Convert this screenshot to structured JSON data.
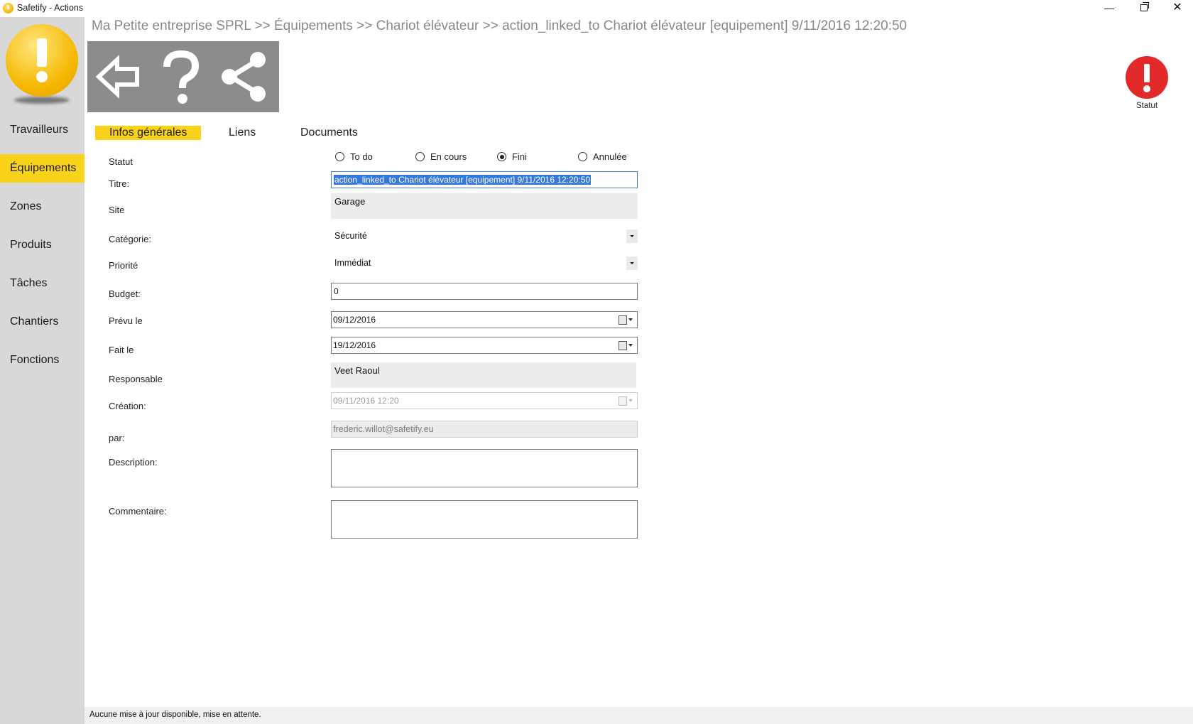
{
  "window": {
    "title": "Safetify - Actions",
    "minimize_glyph": "—",
    "close_glyph": "✕"
  },
  "breadcrumb": "Ma Petite entreprise SPRL >> Équipements >> Chariot élévateur >> action_linked_to Chariot élévateur [equipement]  9/11/2016 12:20:50",
  "sidebar": {
    "items": [
      {
        "label": "Travailleurs",
        "active": false
      },
      {
        "label": "Équipements",
        "active": true
      },
      {
        "label": "Zones",
        "active": false
      },
      {
        "label": "Produits",
        "active": false
      },
      {
        "label": "Tâches",
        "active": false
      },
      {
        "label": "Chantiers",
        "active": false
      },
      {
        "label": "Fonctions",
        "active": false
      }
    ]
  },
  "toolbar": {
    "buttons": [
      "back-arrow-icon",
      "help-question-icon",
      "share-icon"
    ]
  },
  "status_indicator": {
    "label": "Statut",
    "color": "#e32a2a"
  },
  "tabs": [
    {
      "label": "Infos générales",
      "active": true
    },
    {
      "label": "Liens",
      "active": false
    },
    {
      "label": "Documents",
      "active": false
    }
  ],
  "form": {
    "statut": {
      "label": "Statut",
      "options": [
        "To do",
        "En cours",
        "Fini",
        "Annulée"
      ],
      "selected": "Fini"
    },
    "titre": {
      "label": "Titre:",
      "value": "action_linked_to Chariot élévateur [equipement]  9/11/2016 12:20:50"
    },
    "site": {
      "label": "Site",
      "value": "Garage"
    },
    "categorie": {
      "label": "Catégorie:",
      "value": "Sécurité"
    },
    "priorite": {
      "label": "Priorité",
      "value": "Immédiat"
    },
    "budget": {
      "label": "Budget:",
      "value": "0"
    },
    "prevu": {
      "label": "Prévu le",
      "value": "09/12/2016"
    },
    "fait": {
      "label": "Fait le",
      "value": "19/12/2016"
    },
    "responsable": {
      "label": "Responsable",
      "value": "Veet Raoul"
    },
    "creation": {
      "label": "Création:",
      "value": "09/11/2016 12:20"
    },
    "par": {
      "label": "par:",
      "value": "frederic.willot@safetify.eu"
    },
    "description": {
      "label": "Description:",
      "value": ""
    },
    "commentaire": {
      "label": "Commentaire:",
      "value": ""
    }
  },
  "status_bar": "Aucune mise à jour disponible, mise en attente.",
  "colors": {
    "accent_yellow": "#f9d21a",
    "sidebar_bg": "#d8d8d8",
    "toolbar_bg": "#8c8c8c",
    "selection_blue": "#3778d8"
  }
}
